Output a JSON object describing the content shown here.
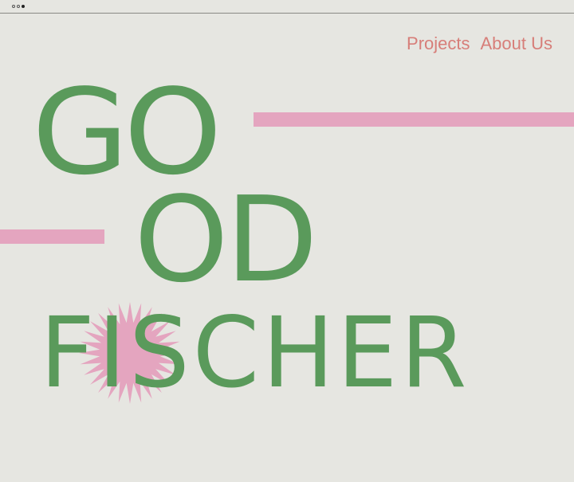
{
  "nav": {
    "items": [
      {
        "label": "Projects"
      },
      {
        "label": "About Us"
      }
    ]
  },
  "hero": {
    "line1": "GO",
    "line2": "OD",
    "line3": "FISCHER"
  },
  "colors": {
    "background": "#e6e6e1",
    "green": "#5a9a5b",
    "pink": "#e4a5bf",
    "nav_text": "#d77e79"
  }
}
